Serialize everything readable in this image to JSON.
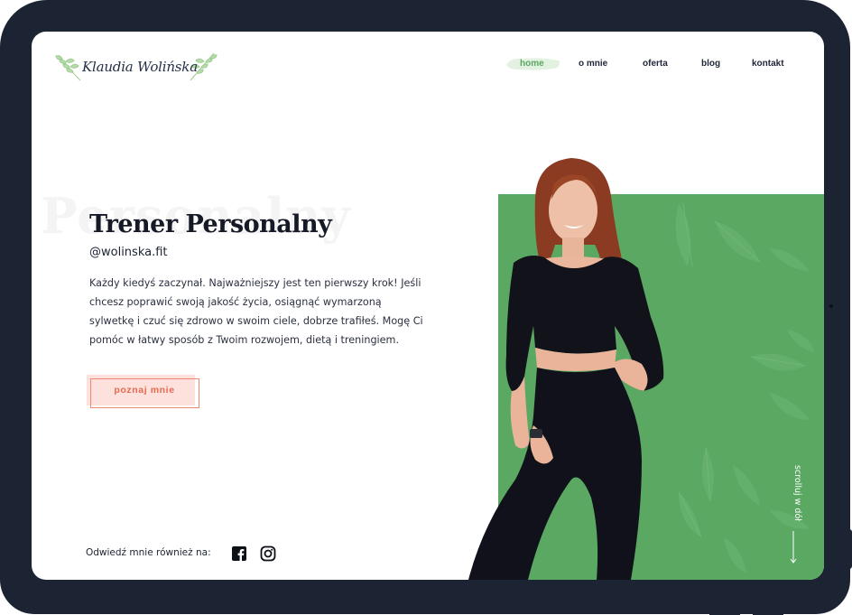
{
  "brand": {
    "name": "Klaudia Wolińska",
    "logo_icon": "leaf-branch-icon"
  },
  "nav": {
    "items": [
      {
        "label": "home",
        "active": true
      },
      {
        "label": "o mnie",
        "active": false
      },
      {
        "label": "oferta",
        "active": false
      },
      {
        "label": "blog",
        "active": false
      },
      {
        "label": "kontakt",
        "active": false
      }
    ]
  },
  "hero": {
    "ghost_word": "Personalny",
    "title": "Trener Personalny",
    "handle": "@wolinska.fit",
    "description": "Każdy kiedyś zaczynał. Najważniejszy jest ten pierwszy krok! Jeśli chcesz poprawić swoją jakość życia, osiągnąć wymarzoną sylwetkę i czuć się zdrowo w swoim ciele, dobrze trafiłeś. Mogę Ci pomóc w łatwy sposób z Twoim rozwojem, dietą i treningiem.",
    "cta_label": "poznaj mnie"
  },
  "social": {
    "label": "Odwiedź mnie również na:",
    "icons": [
      "facebook-icon",
      "instagram-icon"
    ]
  },
  "scroll_hint": "scrolluj w dół",
  "colors": {
    "accent_green": "#5aa862",
    "cta_text": "#e8694f",
    "cta_fill": "#fde1dc",
    "device_frame": "#1c2433",
    "heading": "#151a26"
  }
}
